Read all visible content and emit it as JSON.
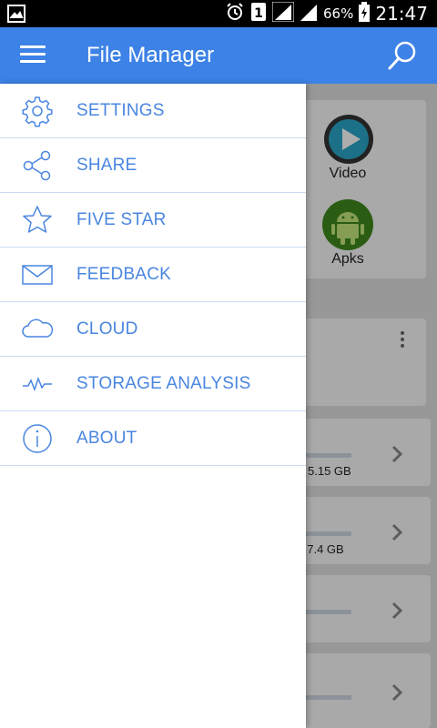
{
  "status_bar": {
    "time": "21:47",
    "battery_percent": "66%",
    "sim_badge": "1",
    "icons": [
      "gallery-icon",
      "alarm-icon",
      "sim-icon",
      "signal-icon",
      "signal-icon",
      "battery-charging-icon"
    ]
  },
  "app_bar": {
    "title": "File Manager",
    "menu_icon": "hamburger-icon",
    "search_icon": "search-icon",
    "color": "#3d82e6"
  },
  "drawer": {
    "accent": "#4a86e0",
    "items": [
      {
        "label": "SETTINGS",
        "icon": "gear-icon"
      },
      {
        "label": "SHARE",
        "icon": "share-icon"
      },
      {
        "label": "FIVE STAR",
        "icon": "star-icon"
      },
      {
        "label": "FEEDBACK",
        "icon": "envelope-icon"
      },
      {
        "label": "CLOUD",
        "icon": "cloud-icon"
      },
      {
        "label": "STORAGE ANALYSIS",
        "icon": "pulse-icon"
      },
      {
        "label": "ABOUT",
        "icon": "info-icon"
      }
    ]
  },
  "background": {
    "tiles": [
      {
        "label": "Video",
        "icon": "video-play-icon"
      },
      {
        "label": "Apks",
        "icon": "android-icon"
      }
    ],
    "storage_rows": [
      {
        "text": "5.15 GB",
        "fill": 0.2
      },
      {
        "text": "/ 7.4 GB",
        "fill": 0.0
      },
      {
        "text": "",
        "fill": 0.0
      },
      {
        "text": "",
        "fill": 0.0
      }
    ]
  }
}
